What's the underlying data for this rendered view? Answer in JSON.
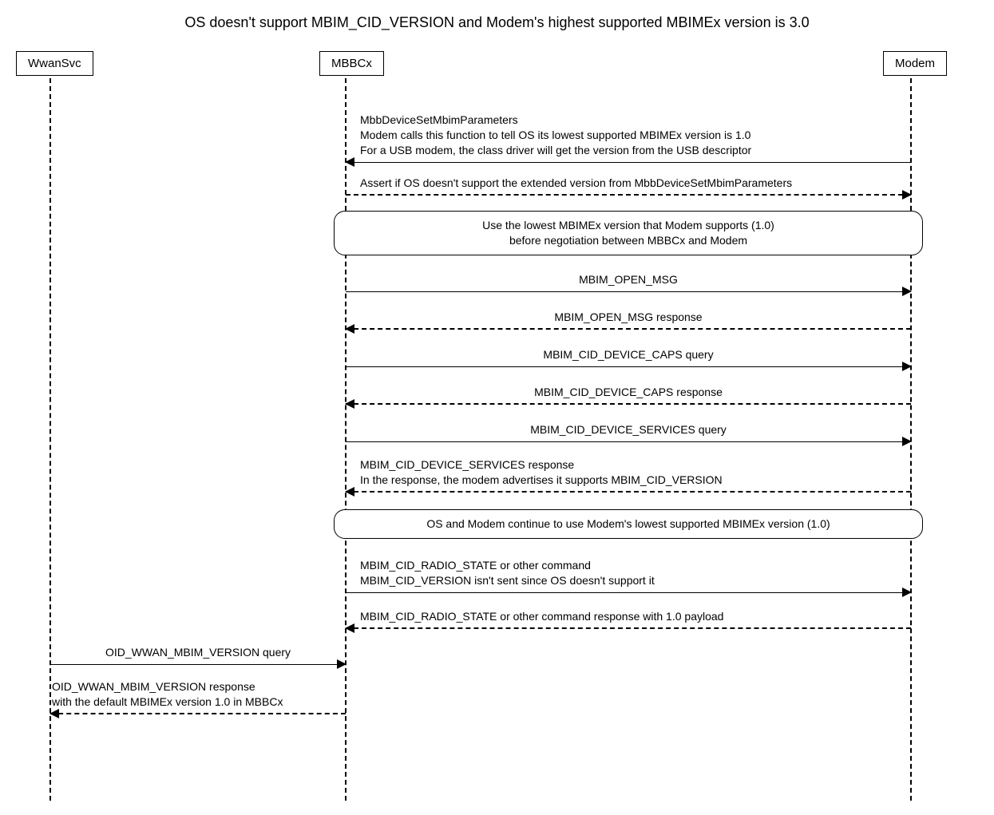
{
  "title": "OS doesn't support MBIM_CID_VERSION and Modem's highest supported MBIMEx version is 3.0",
  "actors": {
    "wwansvc": "WwanSvc",
    "mbbcx": "MBBCx",
    "modem": "Modem"
  },
  "messages": {
    "m1": {
      "line1": "MbbDeviceSetMbimParameters",
      "line2": "Modem calls this function to tell OS its lowest supported MBIMEx version is 1.0",
      "line3": "For a USB modem, the class driver will get the version from the USB descriptor"
    },
    "m2": "Assert if OS doesn't support the extended version from MbbDeviceSetMbimParameters",
    "m3": "MBIM_OPEN_MSG",
    "m4": "MBIM_OPEN_MSG response",
    "m5": "MBIM_CID_DEVICE_CAPS query",
    "m6": "MBIM_CID_DEVICE_CAPS response",
    "m7": "MBIM_CID_DEVICE_SERVICES query",
    "m8": {
      "line1": "MBIM_CID_DEVICE_SERVICES response",
      "line2": "In the response, the modem advertises it supports MBIM_CID_VERSION"
    },
    "m9": {
      "line1": "MBIM_CID_RADIO_STATE or other command",
      "line2": "MBIM_CID_VERSION isn't sent since OS doesn't support it"
    },
    "m10": "MBIM_CID_RADIO_STATE or other command response with 1.0 payload",
    "m11": "OID_WWAN_MBIM_VERSION query",
    "m12": {
      "line1": "OID_WWAN_MBIM_VERSION response",
      "line2": "with the default MBIMEx version 1.0 in MBBCx"
    }
  },
  "notes": {
    "n1": {
      "line1": "Use the lowest MBIMEx version that Modem supports (1.0)",
      "line2": "before negotiation between MBBCx and Modem"
    },
    "n2": "OS and Modem continue to use Modem's lowest supported MBIMEx version (1.0)"
  }
}
